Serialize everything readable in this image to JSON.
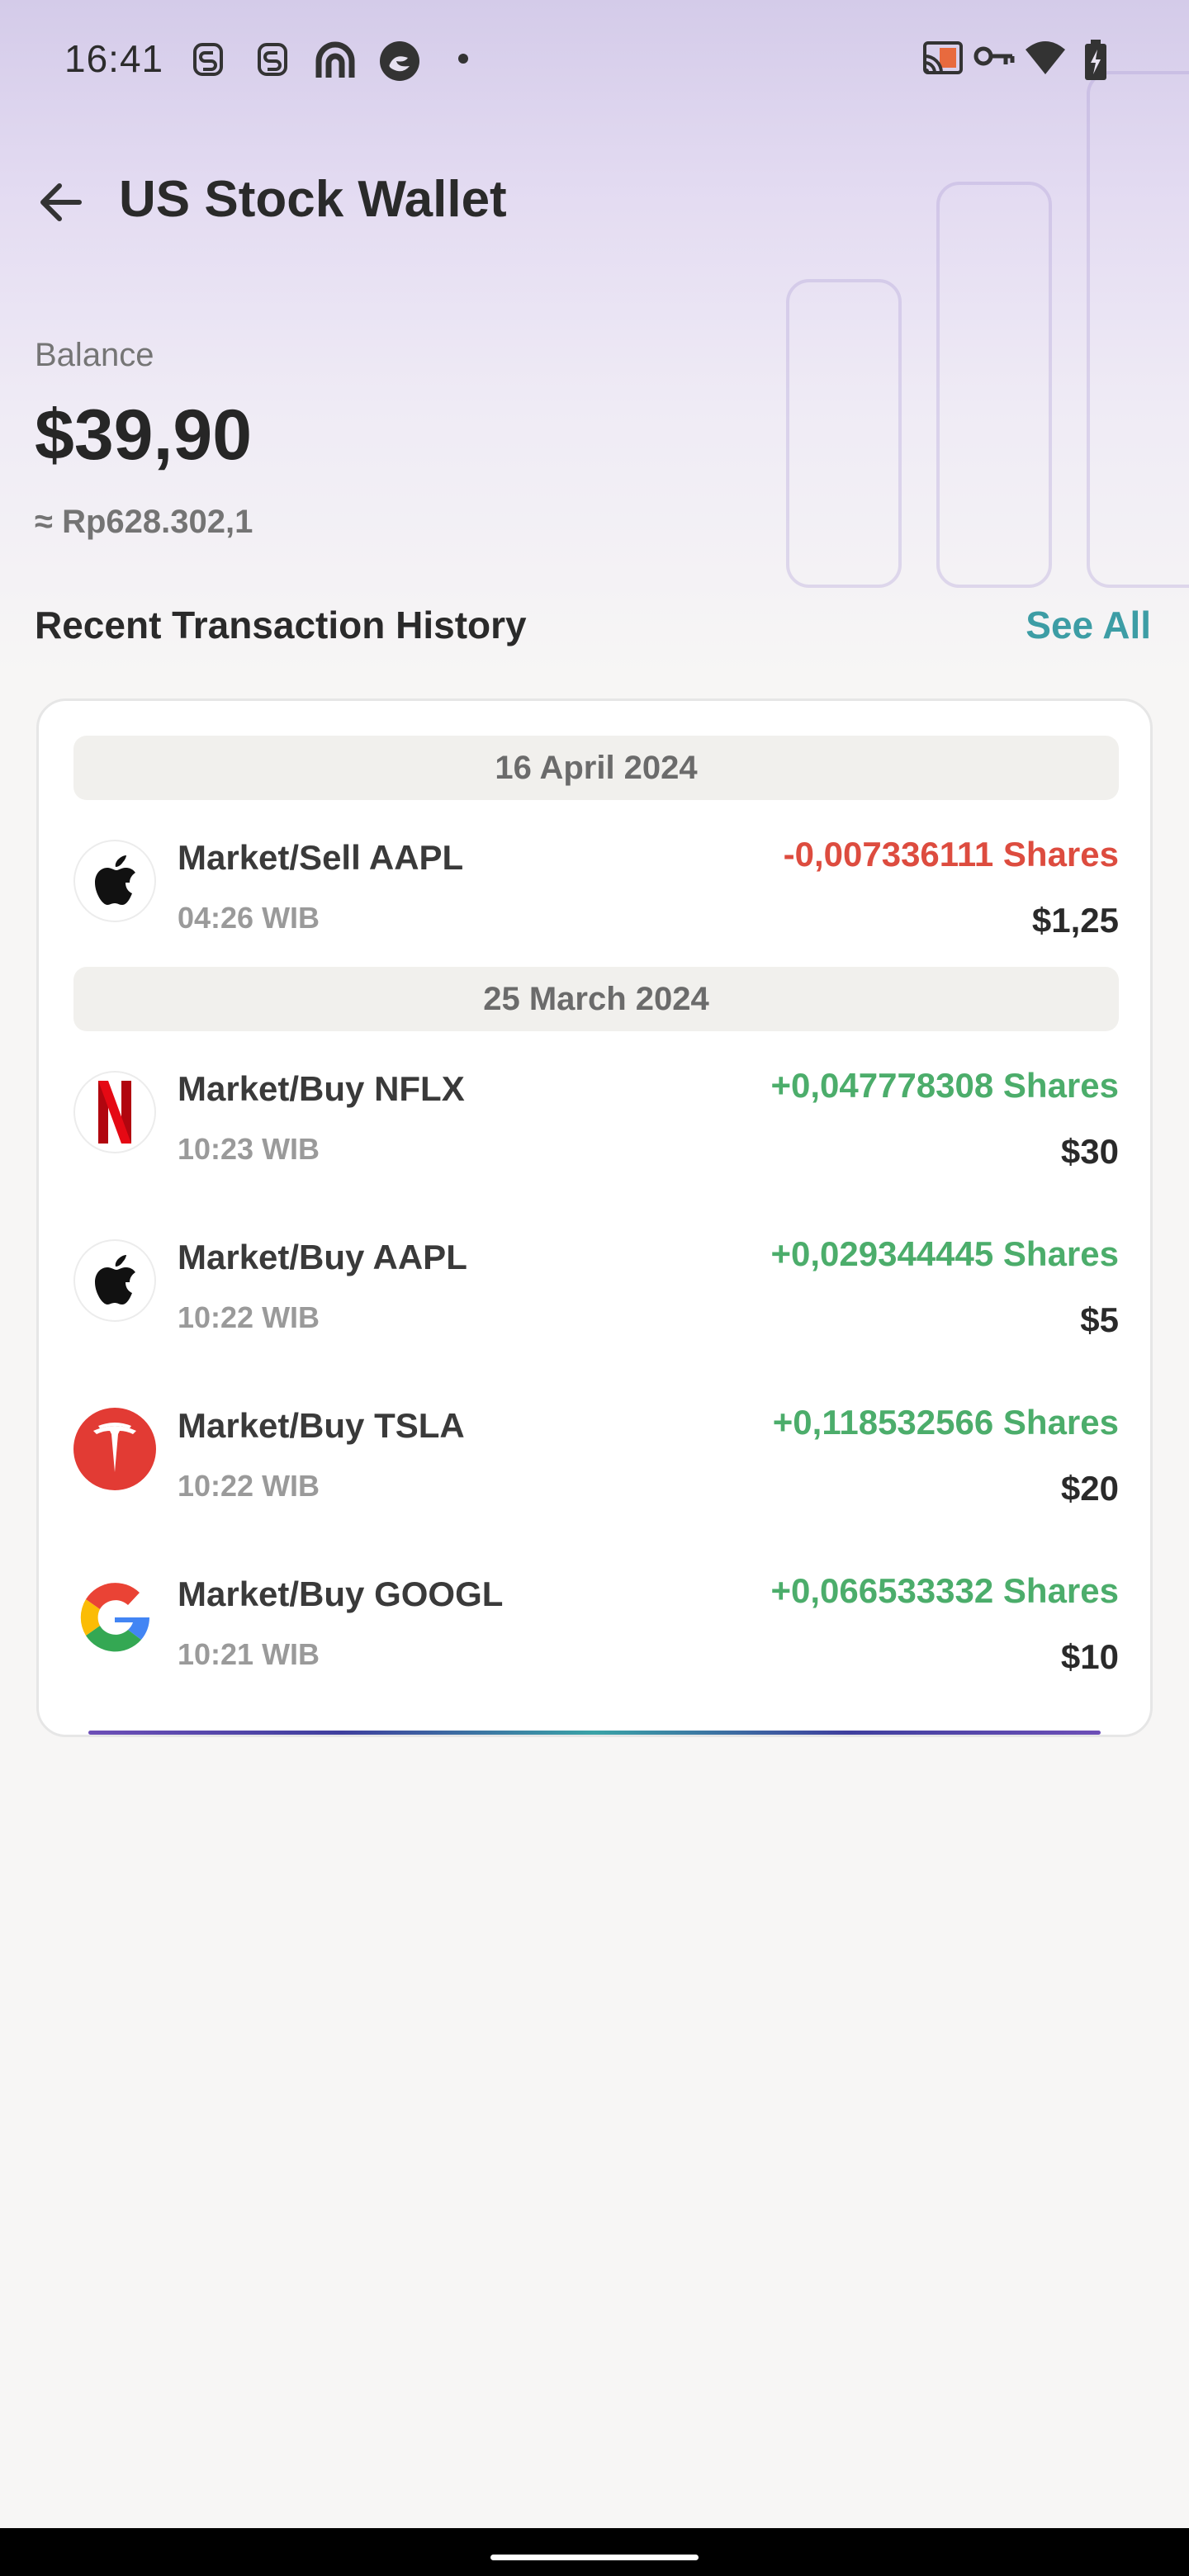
{
  "status_bar": {
    "time": "16:41",
    "left_icons": [
      "s-notification-icon",
      "s-notification-icon",
      "headset-app-icon",
      "edge-browser-icon",
      "dot-icon"
    ],
    "right_icons": [
      "cast-icon",
      "vpn-key-icon",
      "wifi-icon",
      "battery-charging-icon"
    ]
  },
  "header": {
    "title": "US Stock Wallet",
    "back_icon": "arrow-left-icon"
  },
  "balance": {
    "label": "Balance",
    "value": "$39,90",
    "approx": "≈ Rp628.302,1"
  },
  "history": {
    "title": "Recent Transaction History",
    "see_all": "See All",
    "groups": [
      {
        "date": "16 April 2024",
        "transactions": [
          {
            "name": "Market/Sell AAPL",
            "time": "04:26 WIB",
            "shares": "-0,007336111 Shares",
            "amount": "$1,25",
            "logo": "apple-logo-icon",
            "direction": "sell"
          }
        ]
      },
      {
        "date": "25 March 2024",
        "transactions": [
          {
            "name": "Market/Buy NFLX",
            "time": "10:23 WIB",
            "shares": "+0,047778308 Shares",
            "amount": "$30",
            "logo": "netflix-logo-icon",
            "direction": "buy"
          },
          {
            "name": "Market/Buy AAPL",
            "time": "10:22 WIB",
            "shares": "+0,029344445 Shares",
            "amount": "$5",
            "logo": "apple-logo-icon",
            "direction": "buy"
          },
          {
            "name": "Market/Buy TSLA",
            "time": "10:22 WIB",
            "shares": "+0,118532566 Shares",
            "amount": "$20",
            "logo": "tesla-logo-icon",
            "direction": "buy"
          },
          {
            "name": "Market/Buy GOOGL",
            "time": "10:21 WIB",
            "shares": "+0,066533332 Shares",
            "amount": "$10",
            "logo": "google-logo-icon",
            "direction": "buy"
          }
        ]
      }
    ]
  },
  "colors": {
    "accent_teal": "#3d9da5",
    "sell_red": "#dd4c3f",
    "buy_green": "#4cad6b",
    "hero_lavender": "#d4cbe9"
  }
}
